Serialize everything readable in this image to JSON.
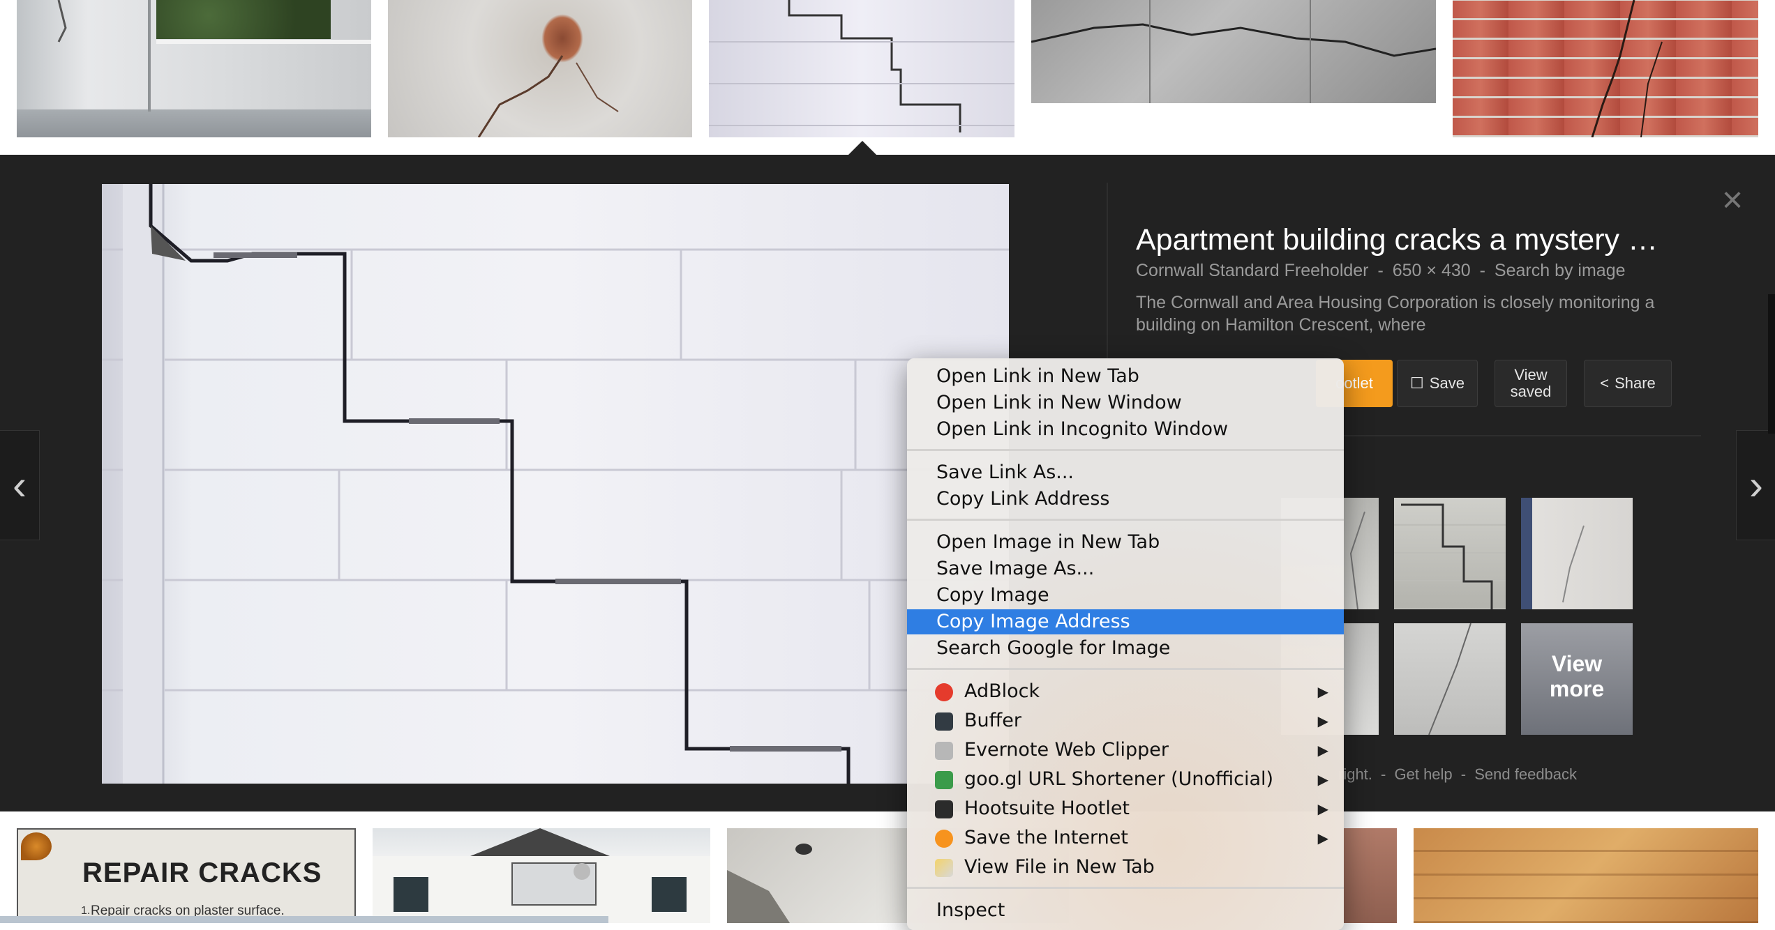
{
  "viewer": {
    "title": "Apartment building cracks a mystery …",
    "source": "Cornwall Standard Freeholder",
    "size": "650 × 430",
    "search_by_image": "Search by image",
    "separator": "-",
    "description": "The Cornwall and Area Housing Corporation is closely monitoring a building on Hamilton Crescent, where",
    "buttons": {
      "hootlet": "ootlet",
      "save": "Save",
      "view_saved_line1": "View",
      "view_saved_line2": "saved",
      "share": "Share"
    },
    "related_more": {
      "line1": "View",
      "line2": "more"
    },
    "footer": {
      "rights": "right.",
      "help": "Get help",
      "feedback": "Send feedback"
    },
    "close_glyph": "×",
    "prev_glyph": "‹",
    "next_glyph": "›"
  },
  "thumbnails": {
    "repair": {
      "title": "REPAIR CRACKS",
      "number": "1.",
      "subtitle": "Repair cracks on plaster surface."
    }
  },
  "context_menu": {
    "items": [
      {
        "label": "Open Link in New Tab"
      },
      {
        "label": "Open Link in New Window"
      },
      {
        "label": "Open Link in Incognito Window"
      },
      {
        "label": "Save Link As..."
      },
      {
        "label": "Copy Link Address"
      },
      {
        "label": "Open Image in New Tab"
      },
      {
        "label": "Save Image As..."
      },
      {
        "label": "Copy Image"
      },
      {
        "label": "Copy Image Address",
        "highlighted": true
      },
      {
        "label": "Search Google for Image"
      },
      {
        "label": "AdBlock",
        "icon": "adblock-icon",
        "submenu": true
      },
      {
        "label": "Buffer",
        "icon": "buffer-icon",
        "submenu": true
      },
      {
        "label": "Evernote Web Clipper",
        "icon": "evernote-icon",
        "submenu": true
      },
      {
        "label": "goo.gl URL Shortener (Unofficial)",
        "icon": "googl-icon",
        "submenu": true
      },
      {
        "label": "Hootsuite Hootlet",
        "icon": "hootsuite-icon",
        "submenu": true
      },
      {
        "label": "Save the Internet",
        "icon": "save-internet-icon",
        "submenu": true
      },
      {
        "label": "View File in New Tab",
        "icon": "view-file-icon",
        "submenu": false
      },
      {
        "label": "Inspect"
      }
    ],
    "submenu_arrow": "▶"
  },
  "colors": {
    "viewer_bg": "#222222",
    "highlight": "#2f7ee3",
    "hootlet_orange": "#f49b1d"
  }
}
